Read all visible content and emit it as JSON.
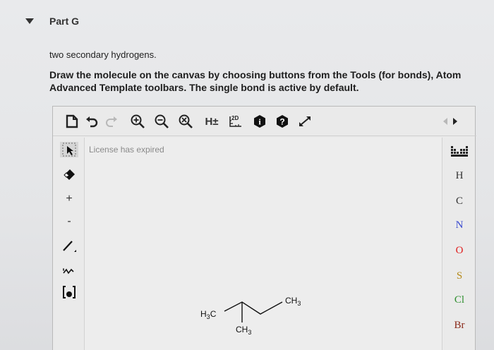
{
  "part": {
    "title": "Part G"
  },
  "question": {
    "line1": "two secondary hydrogens.",
    "instruction_line1": "Draw the molecule on the canvas by choosing buttons from the Tools (for bonds), Atom",
    "instruction_line2": "Advanced Template toolbars. The single bond is active by default."
  },
  "editor": {
    "license_text": "License has expired",
    "toolbar": {
      "h_toggle": "H±",
      "two_d": "2D",
      "info": "i",
      "help": "?"
    },
    "atoms": [
      "H",
      "C",
      "N",
      "O",
      "S",
      "Cl",
      "Br"
    ],
    "atom_colors": {
      "H": "#333333",
      "C": "#333333",
      "N": "#3a4bd0",
      "O": "#e02020",
      "S": "#b58a1a",
      "Cl": "#2f8f2f",
      "Br": "#8a2a1a"
    },
    "molecule": {
      "left_label_main": "H",
      "left_label_sub": "3",
      "left_label_tail": "C",
      "right_label_main": "CH",
      "right_label_sub": "3",
      "bottom_label_main": "CH",
      "bottom_label_sub": "3"
    }
  }
}
